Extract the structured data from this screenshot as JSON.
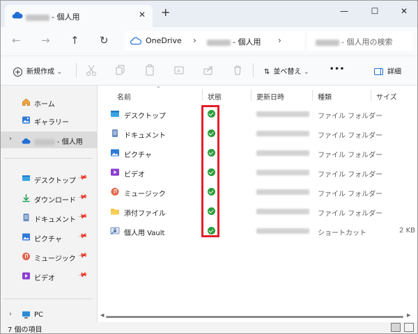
{
  "window": {
    "tab_title": "- 個人用",
    "new_tab": "+",
    "tab_close": "✕",
    "controls": {
      "minimize": "—",
      "maximize": "☐",
      "close": "✕"
    }
  },
  "navigation": {
    "back": "←",
    "forward": "→",
    "up": "↑",
    "refresh": "↻",
    "breadcrumb": [
      "OneDrive",
      "- 個人用"
    ],
    "search_placeholder": "- 個人用の検索"
  },
  "toolbar": {
    "new_label": "新規作成",
    "sort_label": "並べ替え",
    "more_label": "•••",
    "details_label": "詳細"
  },
  "sidebar": {
    "items": [
      {
        "label": "ホーム",
        "icon": "home-icon"
      },
      {
        "label": "ギャラリー",
        "icon": "gallery-icon"
      },
      {
        "label": "- 個人用",
        "icon": "onedrive-icon",
        "selected": true
      }
    ],
    "quick_access": [
      {
        "label": "デスクトップ",
        "icon": "desktop-icon"
      },
      {
        "label": "ダウンロード",
        "icon": "download-icon"
      },
      {
        "label": "ドキュメント",
        "icon": "document-icon"
      },
      {
        "label": "ピクチャ",
        "icon": "pictures-icon"
      },
      {
        "label": "ミュージック",
        "icon": "music-icon"
      },
      {
        "label": "ビデオ",
        "icon": "videos-icon"
      }
    ],
    "pc_label": "PC"
  },
  "file_list": {
    "columns": [
      "名前",
      "状態",
      "更新日時",
      "種類",
      "サイズ"
    ],
    "rows": [
      {
        "name": "デスクトップ",
        "type": "ファイル フォルダー",
        "size": "",
        "icon": "desktop-folder-icon",
        "status": "synced"
      },
      {
        "name": "ドキュメント",
        "type": "ファイル フォルダー",
        "size": "",
        "icon": "documents-folder-icon",
        "status": "synced"
      },
      {
        "name": "ピクチャ",
        "type": "ファイル フォルダー",
        "size": "",
        "icon": "pictures-folder-icon",
        "status": "synced"
      },
      {
        "name": "ビデオ",
        "type": "ファイル フォルダー",
        "size": "",
        "icon": "videos-folder-icon",
        "status": "synced"
      },
      {
        "name": "ミュージック",
        "type": "ファイル フォルダー",
        "size": "",
        "icon": "music-folder-icon",
        "status": "synced"
      },
      {
        "name": "添付ファイル",
        "type": "ファイル フォルダー",
        "size": "",
        "icon": "folder-icon",
        "status": "synced"
      },
      {
        "name": "個人用 Vault",
        "type": "ショートカット",
        "size": "2 KB",
        "icon": "vault-shortcut-icon",
        "status": "synced"
      }
    ]
  },
  "status_bar": {
    "item_count": "7 個の項目"
  },
  "colors": {
    "status_synced": "#2e9e3e",
    "highlight_border": "#e31e2b",
    "onedrive_blue": "#1f6fd6",
    "folder_yellow": "#f4c038"
  }
}
